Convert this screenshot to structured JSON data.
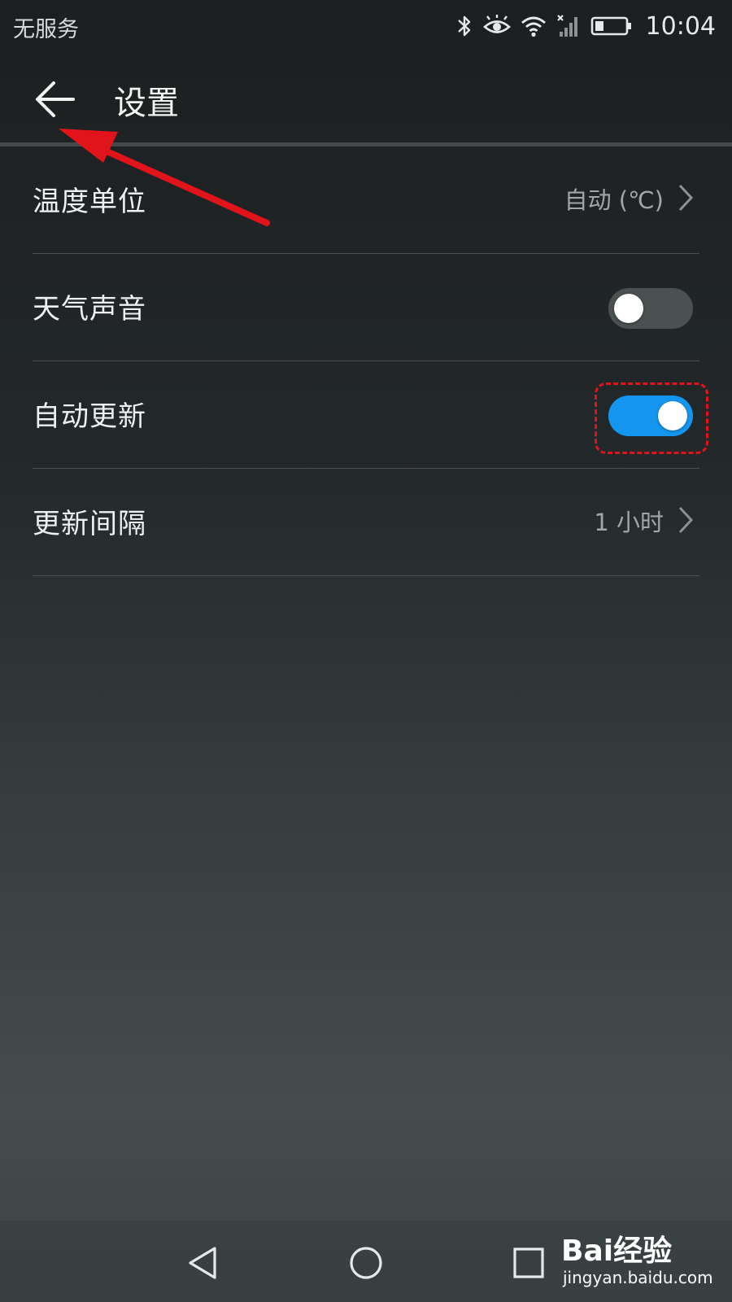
{
  "status_bar": {
    "carrier": "无服务",
    "time": "10:04",
    "icons": [
      "bluetooth-icon",
      "eye-comfort-icon",
      "wifi-icon",
      "no-signal-icon",
      "battery-icon"
    ]
  },
  "app_bar": {
    "title": "设置",
    "back_icon": "back-arrow-icon"
  },
  "settings": [
    {
      "label": "温度单位",
      "value": "自动 (℃)",
      "type": "chevron"
    },
    {
      "label": "天气声音",
      "type": "toggle",
      "on": false
    },
    {
      "label": "自动更新",
      "type": "toggle",
      "on": true
    },
    {
      "label": "更新间隔",
      "value": "1 小时",
      "type": "chevron"
    }
  ],
  "nav_bar": {
    "icons": [
      "back-triangle-icon",
      "home-circle-icon",
      "recents-square-icon"
    ]
  },
  "watermark": {
    "logo": "Bai经验",
    "url": "jingyan.baidu.com"
  },
  "colors": {
    "toggle_on": "#1496f0",
    "toggle_off": "#4b5050",
    "annotation": "#e1141b"
  }
}
